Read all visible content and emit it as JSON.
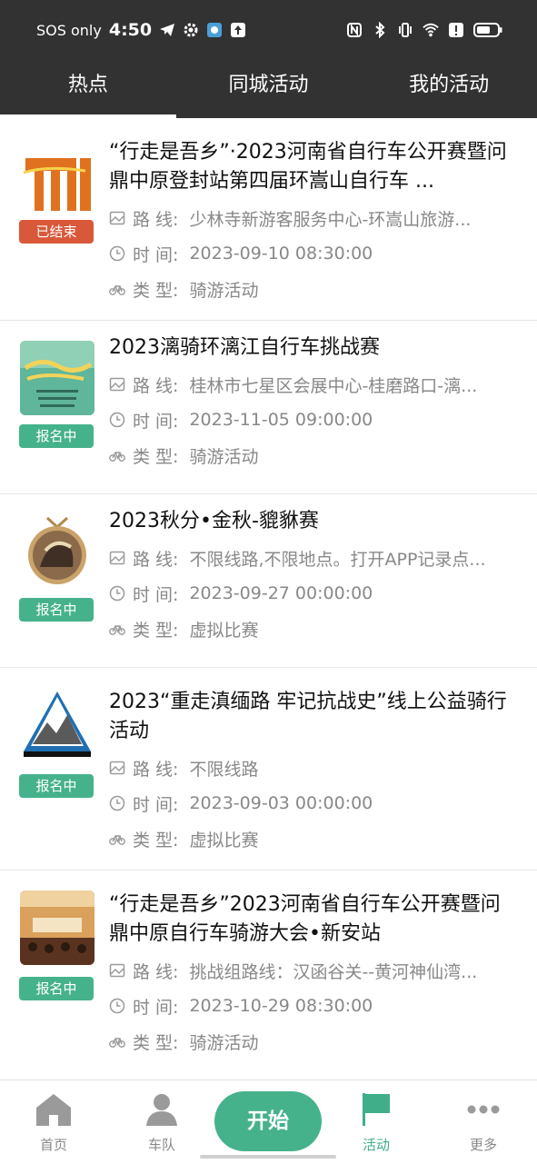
{
  "status_bar": {
    "carrier": "SOS only",
    "time": "4:50"
  },
  "tabs": [
    {
      "label": "热点",
      "active": true
    },
    {
      "label": "同城活动",
      "active": false
    },
    {
      "label": "我的活动",
      "active": false
    }
  ],
  "field_labels": {
    "route": "路  线:",
    "time": "时  间:",
    "type": "类  型:"
  },
  "events": [
    {
      "title": "“行走是吾乡”·2023河南省自行车公开赛暨问鼎中原登封站第四届环嵩山自行车 ...",
      "status": "已结束",
      "status_kind": "ended",
      "route": "少林寺新游客服务中心-环嵩山旅游...",
      "time": "2023-09-10 08:30:00",
      "type": "骑游活动"
    },
    {
      "title": "2023漓骑环漓江自行车挑战赛",
      "status": "报名中",
      "status_kind": "open",
      "route": "桂林市七星区会展中心-桂磨路口-漓...",
      "time": "2023-11-05 09:00:00",
      "type": "骑游活动"
    },
    {
      "title": "2023秋分•金秋-貔貅赛",
      "status": "报名中",
      "status_kind": "open",
      "route": "不限线路,不限地点。打开APP记录点...",
      "time": "2023-09-27 00:00:00",
      "type": "虚拟比赛"
    },
    {
      "title": "2023“重走滇缅路  牢记抗战史”线上公益骑行活动",
      "status": "报名中",
      "status_kind": "open",
      "route": "不限线路",
      "time": "2023-09-03 00:00:00",
      "type": "虚拟比赛"
    },
    {
      "title": "“行走是吾乡”2023河南省自行车公开赛暨问鼎中原自行车骑游大会•新安站",
      "status": "报名中",
      "status_kind": "open",
      "route": "挑战组路线：汉函谷关--黄河神仙湾...",
      "time": "2023-10-29 08:30:00",
      "type": "骑游活动"
    }
  ],
  "bottom_nav": {
    "home": "首页",
    "team": "车队",
    "start": "开始",
    "activity": "活动",
    "more": "更多"
  },
  "colors": {
    "accent": "#46b28c",
    "ended": "#d9583a",
    "header": "#323232"
  }
}
